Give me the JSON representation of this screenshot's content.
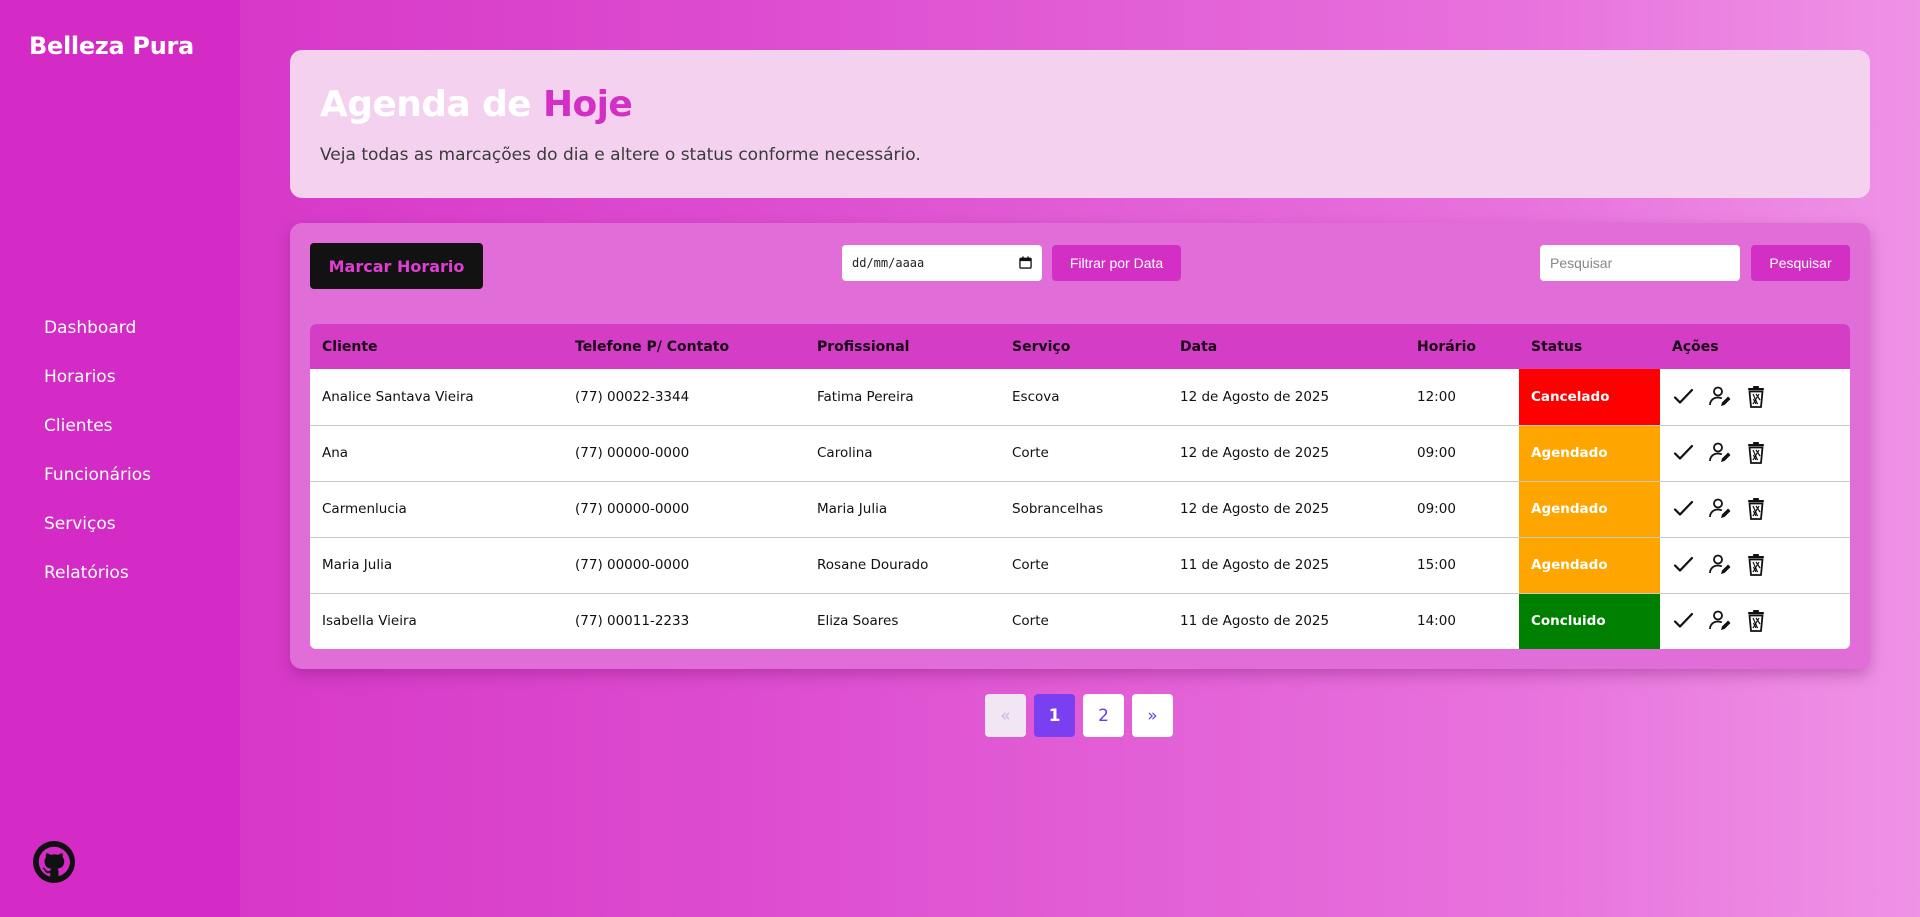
{
  "app": {
    "brand": "Belleza Pura"
  },
  "sidebar": {
    "items": [
      {
        "label": "Dashboard"
      },
      {
        "label": "Horarios"
      },
      {
        "label": "Clientes"
      },
      {
        "label": "Funcionários"
      },
      {
        "label": "Serviços"
      },
      {
        "label": "Relatórios"
      }
    ],
    "footer_icon": "github-icon"
  },
  "header": {
    "title_main": "Agenda de",
    "title_accent": "Hoje",
    "subtitle": "Veja todas as marcações do dia e altere o status conforme necessário."
  },
  "toolbar": {
    "marcar_label": "Marcar Horario",
    "date_placeholder": "dd/mm/aaaa",
    "filtrar_label": "Filtrar por Data",
    "search_placeholder": "Pesquisar",
    "pesquisar_label": "Pesquisar"
  },
  "table": {
    "headers": [
      "Cliente",
      "Telefone P/ Contato",
      "Profissional",
      "Serviço",
      "Data",
      "Horário",
      "Status",
      "Ações"
    ],
    "rows": [
      {
        "cliente": "Analice Santava Vieira",
        "telefone": "(77) 00022-3344",
        "profissional": "Fatima Pereira",
        "servico": "Escova",
        "data": "12 de Agosto de 2025",
        "horario": "12:00",
        "status": "Cancelado"
      },
      {
        "cliente": "Ana",
        "telefone": "(77) 00000-0000",
        "profissional": "Carolina",
        "servico": "Corte",
        "data": "12 de Agosto de 2025",
        "horario": "09:00",
        "status": "Agendado"
      },
      {
        "cliente": "Carmenlucia",
        "telefone": "(77) 00000-0000",
        "profissional": "Maria Julia",
        "servico": "Sobrancelhas",
        "data": "12 de Agosto de 2025",
        "horario": "09:00",
        "status": "Agendado"
      },
      {
        "cliente": "Maria Julia",
        "telefone": "(77) 00000-0000",
        "profissional": "Rosane Dourado",
        "servico": "Corte",
        "data": "11 de Agosto de 2025",
        "horario": "15:00",
        "status": "Agendado"
      },
      {
        "cliente": "Isabella Vieira",
        "telefone": "(77) 00011-2233",
        "profissional": "Eliza Soares",
        "servico": "Corte",
        "data": "11 de Agosto de 2025",
        "horario": "14:00",
        "status": "Concluido"
      }
    ],
    "action_icons": [
      "check-icon",
      "edit-user-icon",
      "trash-icon"
    ]
  },
  "status_colors": {
    "Cancelado": "#ff0000",
    "Agendado": "#ffa500",
    "Concluido": "#008000"
  },
  "pagination": {
    "prev": "«",
    "pages": [
      "1",
      "2"
    ],
    "current": "1",
    "next": "»"
  },
  "colors": {
    "accent": "#d42fc4",
    "sidebar": "#d42bc6",
    "page_active": "#7b3ff2"
  }
}
